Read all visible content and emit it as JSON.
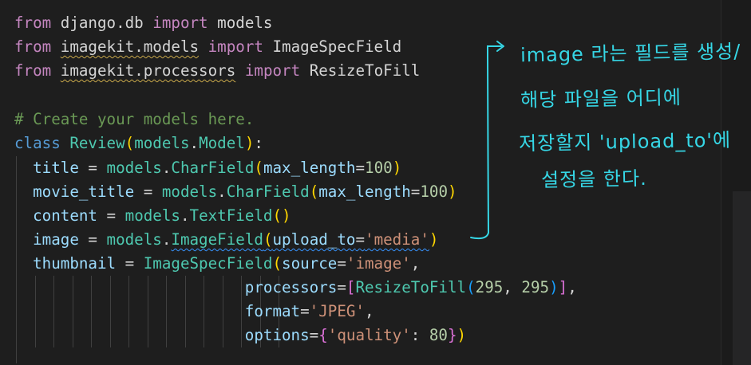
{
  "code": {
    "line1": {
      "kw_from": "from",
      "module": " django.db ",
      "kw_import": "import",
      "name": " models"
    },
    "line2": {
      "kw_from": "from",
      "module_pre": " ",
      "module": "imagekit.models",
      "module_post": " ",
      "kw_import": "import",
      "name": " ImageSpecField"
    },
    "line3": {
      "kw_from": "from",
      "module_pre": " ",
      "module": "imagekit.processors",
      "module_post": " ",
      "kw_import": "import",
      "name": " ResizeToFill"
    },
    "line5": {
      "comment": "# Create your models here."
    },
    "line6": {
      "kw_class": "class",
      "space": " ",
      "cls_name": "Review",
      "open": "(",
      "base_mod": "models",
      "dot": ".",
      "base_cls": "Model",
      "close": ")",
      "colon": ":"
    },
    "line7": {
      "indent": "  ",
      "var": "title",
      "eq": " = ",
      "mod": "models",
      "dot": ".",
      "cls": "CharField",
      "open": "(",
      "param": "max_length",
      "pe": "=",
      "num": "100",
      "close": ")"
    },
    "line8": {
      "indent": "  ",
      "var": "movie_title",
      "eq": " = ",
      "mod": "models",
      "dot": ".",
      "cls": "CharField",
      "open": "(",
      "param": "max_length",
      "pe": "=",
      "num": "100",
      "close": ")"
    },
    "line9": {
      "indent": "  ",
      "var": "content",
      "eq": " = ",
      "mod": "models",
      "dot": ".",
      "cls": "TextField",
      "open": "(",
      "close": ")"
    },
    "line10": {
      "indent": "  ",
      "var": "image",
      "eq": " = ",
      "mod": "models",
      "dot": ".",
      "cls": "ImageField",
      "open": "(",
      "param": "upload_to",
      "pe": "=",
      "str": "'media'",
      "close": ")"
    },
    "line11": {
      "indent": "  ",
      "var": "thumbnail",
      "eq": " = ",
      "cls": "ImageSpecField",
      "open": "(",
      "param": "source",
      "pe": "=",
      "str": "'image'",
      "comma": ","
    },
    "line12": {
      "indent": "                         ",
      "param": "processors",
      "pe": "=",
      "lb": "[",
      "cls": "ResizeToFill",
      "open": "(",
      "n1": "295",
      "sep": ", ",
      "n2": "295",
      "close": ")",
      "rb": "]",
      "comma": ","
    },
    "line13": {
      "indent": "                         ",
      "param": "format",
      "pe": "=",
      "str": "'JPEG'",
      "comma": ","
    },
    "line14": {
      "indent": "                         ",
      "param": "options",
      "pe": "=",
      "lb": "{",
      "key": "'quality'",
      "colon": ": ",
      "num": "80",
      "rb": "}",
      "close": ")"
    }
  },
  "annotation": {
    "line1": "image 라는 필드를 생성/",
    "line2": "해당 파일을 어디에",
    "line3": "저장할지 'upload_to'에",
    "line4": "설정을 한다."
  },
  "colors": {
    "background": "#1e1e1e",
    "annotation_ink": "#36d7e6"
  }
}
